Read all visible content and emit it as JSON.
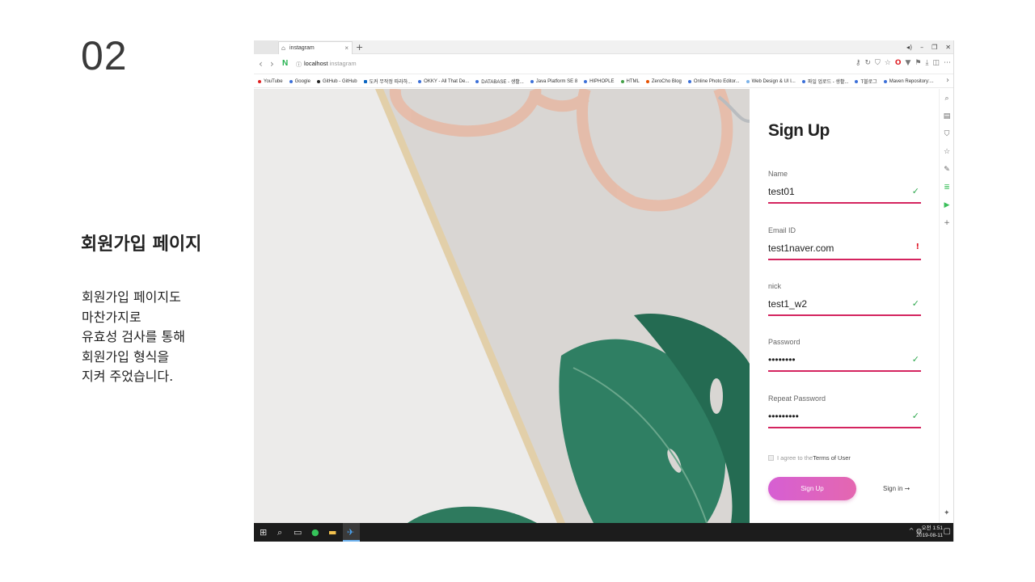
{
  "slide": {
    "number": "02",
    "title": "회원가입 페이지",
    "description": [
      "회원가입 페이지도",
      "마찬가지로",
      "유효성 검사를 통해",
      "회원가입 형식을",
      "지켜 주었습니다."
    ]
  },
  "browser": {
    "tab_title": "instagram",
    "url_host": "localhost",
    "url_path": "instagram",
    "bookmarks": [
      "YouTube",
      "Google",
      "GitHub",
      "GitHub",
      "도커 무작정 따라하...",
      "OKKY - All That De...",
      "DATABASE - 생활...",
      "Java Platform SE 8",
      "HIPHOPLE",
      "HTML",
      "ZeroCho Blog",
      "Online Photo Editor...",
      "Web Design & UI I...",
      "파일 업로드 - 생활...",
      "T블로그",
      "Maven Repository:..."
    ]
  },
  "signup": {
    "title": "Sign Up",
    "fields": [
      {
        "label": "Name",
        "value": "test01",
        "status": "✓"
      },
      {
        "label": "Email ID",
        "value": "test1naver.com",
        "status": "!"
      },
      {
        "label": "nick",
        "value": "test1_w2",
        "status": "✓"
      },
      {
        "label": "Password",
        "value": "••••••••",
        "status": "✓"
      },
      {
        "label": "Repeat Password",
        "value": "•••••••••",
        "status": "✓"
      }
    ],
    "agree_prefix": "I agree to the",
    "agree_terms": "Terms of User",
    "submit_label": "Sign Up",
    "signin_label": "Sign in ➞"
  },
  "taskbar": {
    "time": "오전 1:51",
    "date": "2019-08-11"
  },
  "colors": {
    "accent_line": "#d4245f",
    "button_gradient_start": "#d65fd3",
    "button_gradient_end": "#e467b0",
    "valid": "#2fa84f",
    "error": "#e01a2b"
  }
}
